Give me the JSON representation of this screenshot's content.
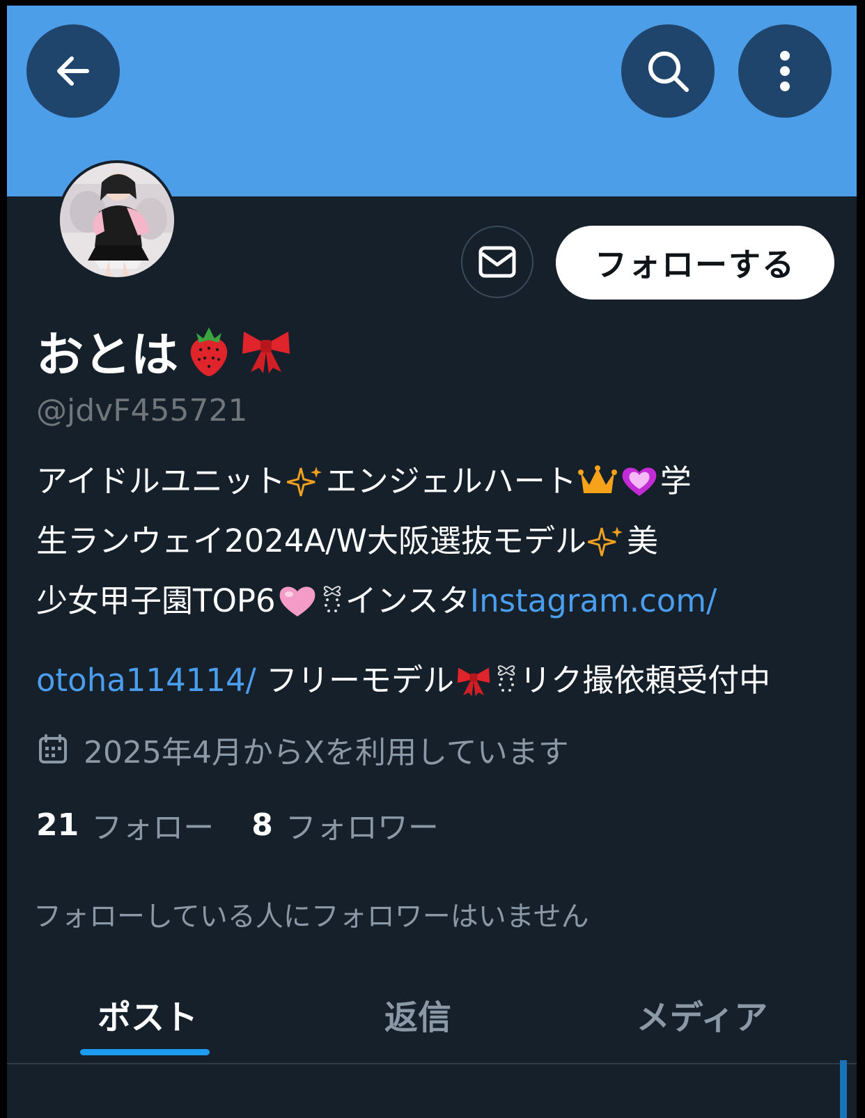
{
  "header": {
    "back_icon": "arrow-left-icon",
    "search_icon": "search-icon",
    "more_icon": "more-vertical-icon"
  },
  "profile": {
    "display_name": "おとは",
    "name_emojis": [
      "strawberry-emoji",
      "ribbon-emoji"
    ],
    "handle": "@jdvF455721",
    "follow_label": "フォローする",
    "message_icon": "mail-icon"
  },
  "bio": {
    "l1a": "アイドルユニット",
    "l1b": "エンジェルハート",
    "l1c": "学",
    "l2a": "生ランウェイ2024A/W大阪選抜モデル",
    "l2b": "美",
    "l3a": "少女甲子園TOP6",
    "l3b": "インスタ",
    "l3link": "Instagram.com/",
    "l4link": "otoha114114/",
    "l4a": " フリーモデル",
    "l4b": "リク撮依頼受付中"
  },
  "joined": {
    "icon": "calendar-icon",
    "text": "2025年4月からXを利用しています"
  },
  "counts": {
    "following_num": "21",
    "following_label": "フォロー",
    "followers_num": "8",
    "followers_label": "フォロワー"
  },
  "no_mutual": "フォローしている人にフォロワーはいません",
  "tabs": [
    {
      "label": "ポスト",
      "active": true
    },
    {
      "label": "返信",
      "active": false
    },
    {
      "label": "メディア",
      "active": false
    }
  ],
  "colors": {
    "banner": "#4d9ee9",
    "background": "#15202b",
    "link": "#4b9ded",
    "accent": "#1d9bf0"
  }
}
